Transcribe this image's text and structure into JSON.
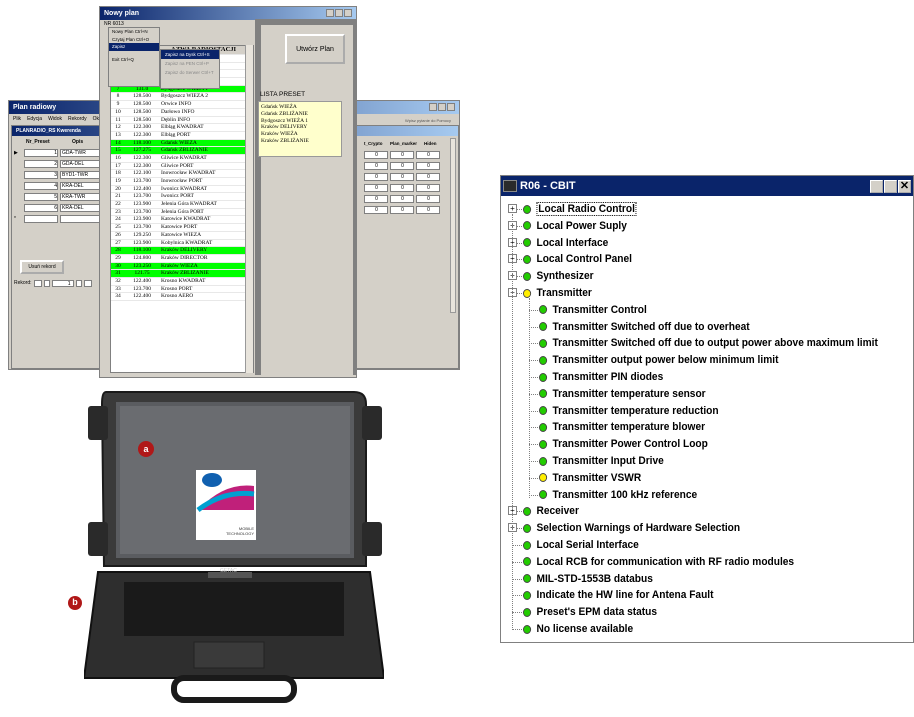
{
  "plan_window": {
    "title": "Nowy plan",
    "subtitle": "NR 6013",
    "menu": [
      "Nowy Plan Ctrl+N",
      "Czytaj Plan Ctrl+O",
      "Zapisz",
      "Exit Ctrl+Q"
    ],
    "submenu": [
      "Zapisz na Dysk Ctrl+S",
      "Zapisz na PEN Ctrl+P",
      "Zapisz do Serwer Ctrl+T"
    ],
    "column_header": "AZWA RADIOSTACJI",
    "first_row_name": "ABICE INFO",
    "rows": [
      {
        "n": "4",
        "f": "122.200",
        "name": "Bielsko INFO",
        "hl": false
      },
      {
        "n": "5",
        "f": "122.200",
        "name": "Bielsko KWADRAT",
        "hl": false
      },
      {
        "n": "6",
        "f": "123.700",
        "name": "Bielsko PORT",
        "hl": false
      },
      {
        "n": "7",
        "f": "131.0",
        "name": "Bydgoszcz WIEŻA 1",
        "hl": true
      },
      {
        "n": "8",
        "f": "128.500",
        "name": "Bydgoszcz WIEŻA 2",
        "hl": false
      },
      {
        "n": "9",
        "f": "128.500",
        "name": "Orwice INFO",
        "hl": false
      },
      {
        "n": "10",
        "f": "128.500",
        "name": "Darłowo INFO",
        "hl": false
      },
      {
        "n": "11",
        "f": "128.500",
        "name": "Dęblin INFO",
        "hl": false
      },
      {
        "n": "12",
        "f": "122.300",
        "name": "Elbląg KWADRAT",
        "hl": false
      },
      {
        "n": "13",
        "f": "122.300",
        "name": "Elbląg PORT",
        "hl": false
      },
      {
        "n": "14",
        "f": "118.100",
        "name": "Gdańsk WIEŻA",
        "hl": true
      },
      {
        "n": "15",
        "f": "127.275",
        "name": "Gdańsk ZBLIŻANIE",
        "hl": true
      },
      {
        "n": "16",
        "f": "122.300",
        "name": "Gliwice KWADRAT",
        "hl": false
      },
      {
        "n": "17",
        "f": "122.300",
        "name": "Gliwice PORT",
        "hl": false
      },
      {
        "n": "18",
        "f": "122.100",
        "name": "Inowrocław KWADRAT",
        "hl": false
      },
      {
        "n": "19",
        "f": "123.700",
        "name": "Inowrocław PORT",
        "hl": false
      },
      {
        "n": "20",
        "f": "122.400",
        "name": "Iwonicz KWADRAT",
        "hl": false
      },
      {
        "n": "21",
        "f": "123.700",
        "name": "Iwonicz PORT",
        "hl": false
      },
      {
        "n": "22",
        "f": "123.900",
        "name": "Jelenia Góra KWADRAT",
        "hl": false
      },
      {
        "n": "23",
        "f": "123.700",
        "name": "Jelenia Góra PORT",
        "hl": false
      },
      {
        "n": "24",
        "f": "123.900",
        "name": "Katowice KWADRAT",
        "hl": false
      },
      {
        "n": "25",
        "f": "123.700",
        "name": "Katowice PORT",
        "hl": false
      },
      {
        "n": "26",
        "f": "129.250",
        "name": "Katowice WIEŻA",
        "hl": false
      },
      {
        "n": "27",
        "f": "123.900",
        "name": "Kobylnica KWADRAT",
        "hl": false
      },
      {
        "n": "28",
        "f": "118.100",
        "name": "Kraków DELIVERY",
        "hl": true
      },
      {
        "n": "29",
        "f": "124.800",
        "name": "Kraków DIRECTOR",
        "hl": false
      },
      {
        "n": "30",
        "f": "123.250",
        "name": "Kraków WIEŻA",
        "hl": true
      },
      {
        "n": "31",
        "f": "121.75",
        "name": "Kraków ZBLIŻANIE",
        "hl": true
      },
      {
        "n": "32",
        "f": "122.400",
        "name": "Krosno KWADRAT",
        "hl": false
      },
      {
        "n": "33",
        "f": "123.700",
        "name": "Krosno PORT",
        "hl": false
      },
      {
        "n": "34",
        "f": "122.400",
        "name": "Krosno AERO",
        "hl": false
      }
    ],
    "create_button": "Utwórz Plan",
    "preset_label": "LISTA PRESET",
    "preset_items": [
      "Gdańsk WIEŻA",
      "Gdańsk ZBLIŻANIE",
      "Bydgoszcz WIEŻA 1",
      "Kraków DELIVERY",
      "Kraków WIEŻA",
      "Kraków ZBLIŻANIE"
    ]
  },
  "access_window": {
    "title": "Plan radiowy",
    "menu": [
      "Plik",
      "Edycja",
      "Widok",
      "Rekordy",
      "Okno"
    ],
    "help_hint": "Wpisz pytanie do Pomocy",
    "subtitle": "PLANRADIO_RS Kwerenda",
    "headers": [
      "Nr_Preset",
      "Opis"
    ],
    "right_headers": [
      "t_Crypto",
      "Plan_marker",
      "Hiden"
    ],
    "rows": [
      {
        "n": "1",
        "opis": "GDA-TWR",
        "f": "118.1"
      },
      {
        "n": "2",
        "opis": "GDA-DEL",
        "f": "127.2"
      },
      {
        "n": "3",
        "opis": "BYD1-TWR",
        "f": "131.0"
      },
      {
        "n": "4",
        "opis": "KRA-DEL",
        "f": "118.1"
      },
      {
        "n": "5",
        "opis": "KRA-TWR",
        "f": "123.2"
      },
      {
        "n": "6",
        "opis": "KRA-DEL",
        "f": "121.7"
      }
    ],
    "right_value": "0",
    "delete_button": "Usuń rekord",
    "record_label": "Rekord:",
    "record_value": "1"
  },
  "laptop": {
    "label_a": "a",
    "label_b": "b",
    "logo_top": "centrino",
    "logo_bottom": "MOBILE TECHNOLOGY",
    "brand": "GETAC"
  },
  "cbit": {
    "title": "R06 - CBIT",
    "colors": {
      "green": "#22cc00",
      "yellow": "#ffee00",
      "title_bg": "#0a246a"
    },
    "top_before": [
      {
        "label": "Local Radio Control",
        "color": "green",
        "expander": "+",
        "selected": true
      },
      {
        "label": "Local Power Suply",
        "color": "green",
        "expander": "+"
      },
      {
        "label": "Local Interface",
        "color": "green",
        "expander": "+"
      },
      {
        "label": "Local Control Panel",
        "color": "green",
        "expander": "+"
      },
      {
        "label": "Synthesizer",
        "color": "green",
        "expander": "+"
      },
      {
        "label": "Transmitter",
        "color": "yellow",
        "expander": "-"
      }
    ],
    "transmitter_children": [
      {
        "label": "Transmitter Control",
        "color": "green"
      },
      {
        "label": "Transmitter Switched off due to overheat",
        "color": "green"
      },
      {
        "label": "Transmitter Switched off due to output power above maximum limit",
        "color": "green"
      },
      {
        "label": "Transmitter output power below minimum limit",
        "color": "green"
      },
      {
        "label": "Transmitter PIN diodes",
        "color": "green"
      },
      {
        "label": "Transmitter temperature sensor",
        "color": "green"
      },
      {
        "label": "Transmitter temperature reduction",
        "color": "green"
      },
      {
        "label": "Transmitter temperature blower",
        "color": "green"
      },
      {
        "label": "Transmitter Power Control Loop",
        "color": "green"
      },
      {
        "label": "Transmitter Input Drive",
        "color": "green"
      },
      {
        "label": "Transmitter VSWR",
        "color": "yellow"
      },
      {
        "label": "Transmitter 100 kHz reference",
        "color": "green"
      }
    ],
    "top_after": [
      {
        "label": "Receiver",
        "color": "green",
        "expander": "+"
      },
      {
        "label": "Selection Warnings of Hardware Selection",
        "color": "green",
        "expander": "+"
      },
      {
        "label": "Local Serial Interface",
        "color": "green"
      },
      {
        "label": "Local RCB for communication with RF radio modules",
        "color": "green"
      },
      {
        "label": "MIL-STD-1553B databus",
        "color": "green"
      },
      {
        "label": "Indicate the HW line for Antena Fault",
        "color": "green"
      },
      {
        "label": "Preset's EPM data status",
        "color": "green"
      },
      {
        "label": "No license available",
        "color": "green"
      }
    ]
  }
}
